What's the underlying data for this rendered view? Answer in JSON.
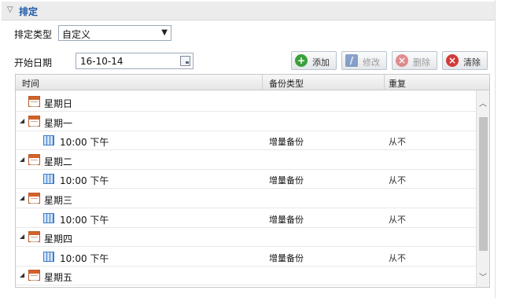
{
  "section": {
    "title": "排定"
  },
  "schedule_type": {
    "label": "排定类型",
    "value": "自定义"
  },
  "start_date": {
    "label": "开始日期",
    "value": "16-10-14"
  },
  "toolbar": {
    "add": "添加",
    "modify": "修改",
    "delete": "删除",
    "clear": "清除"
  },
  "columns": {
    "time": "时间",
    "backup_type": "备份类型",
    "repeat": "重复"
  },
  "rows": [
    {
      "kind": "day",
      "label": "星期日",
      "expandable": false
    },
    {
      "kind": "day",
      "label": "星期一",
      "expandable": true
    },
    {
      "kind": "time",
      "label": "10:00 下午",
      "backup_type": "增量备份",
      "repeat": "从不"
    },
    {
      "kind": "day",
      "label": "星期二",
      "expandable": true
    },
    {
      "kind": "time",
      "label": "10:00 下午",
      "backup_type": "增量备份",
      "repeat": "从不"
    },
    {
      "kind": "day",
      "label": "星期三",
      "expandable": true
    },
    {
      "kind": "time",
      "label": "10:00 下午",
      "backup_type": "增量备份",
      "repeat": "从不"
    },
    {
      "kind": "day",
      "label": "星期四",
      "expandable": true
    },
    {
      "kind": "time",
      "label": "10:00 下午",
      "backup_type": "增量备份",
      "repeat": "从不"
    },
    {
      "kind": "day",
      "label": "星期五",
      "expandable": true
    }
  ],
  "colors": {
    "accent": "#1c57a8",
    "add_icon": "#3aa13a",
    "modify_icon": "#2f5ea8",
    "delete_icon": "#d23a3a",
    "clear_icon": "#d23a3a"
  }
}
